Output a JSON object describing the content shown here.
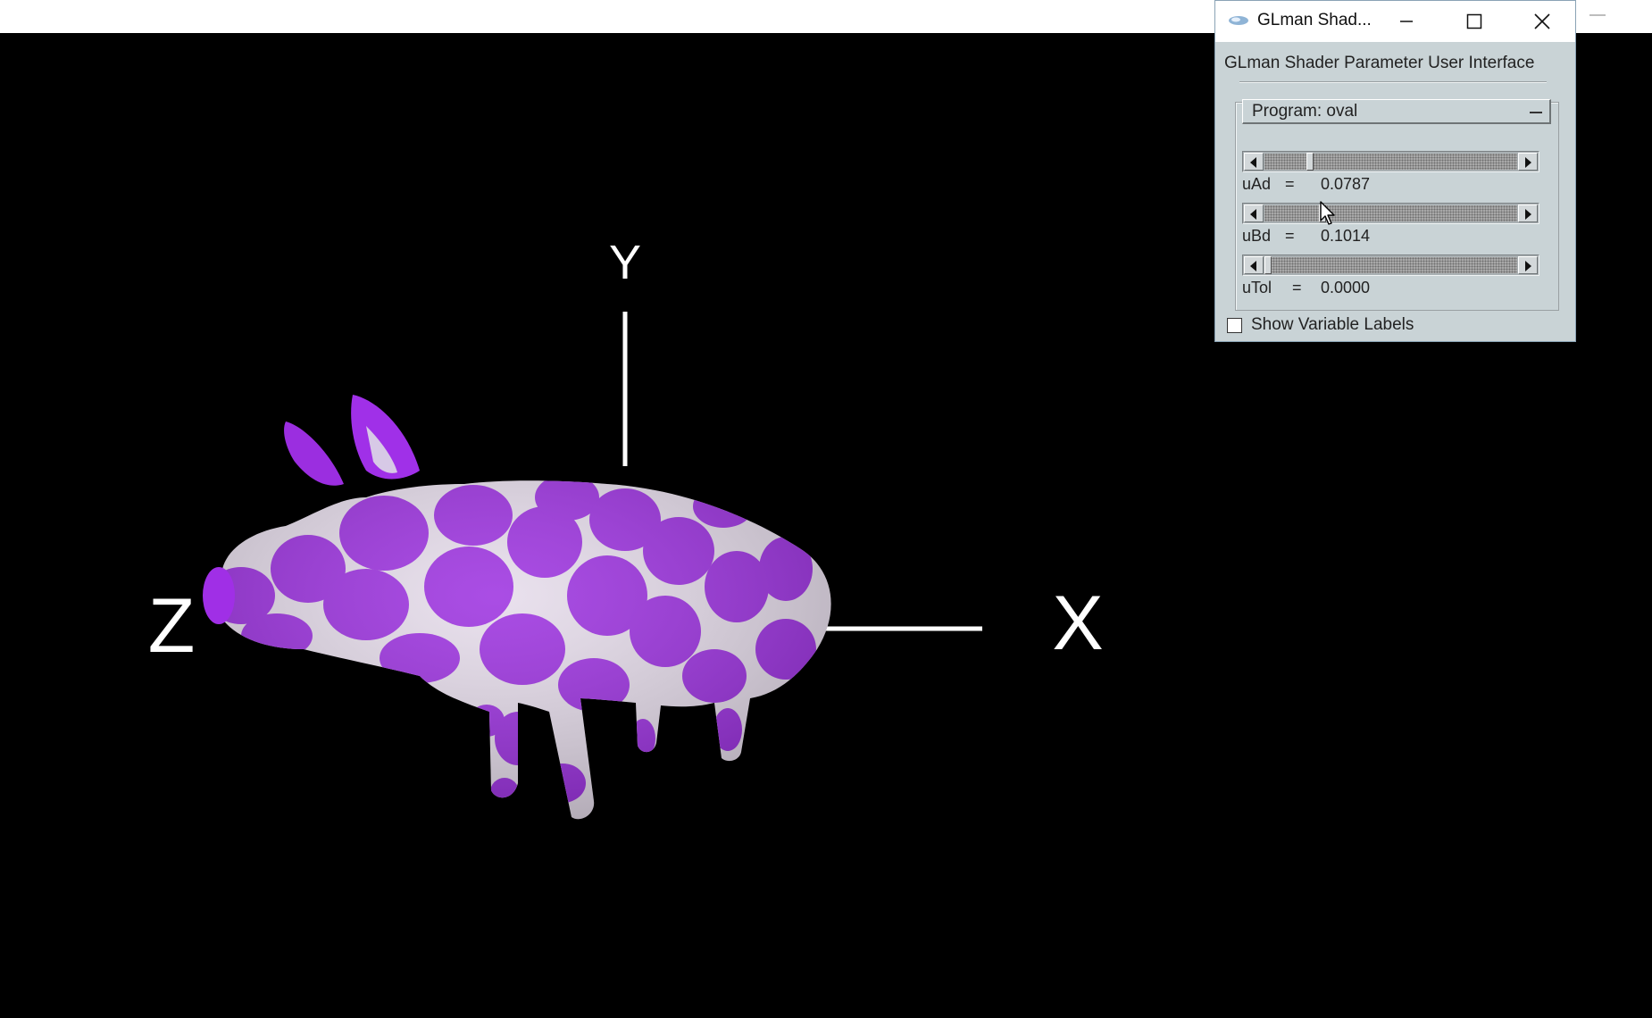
{
  "viewport": {
    "axis_labels": {
      "x": "X",
      "y": "Y",
      "z": "Z"
    },
    "model": "pig",
    "colors": {
      "background": "#000000",
      "axes": "#ffffff",
      "spot": "#9b2ee0",
      "base": "#e9dff0"
    }
  },
  "dialog": {
    "title": "GLman Shad...",
    "heading": "GLman Shader Parameter User Interface",
    "program_label": "Program: oval",
    "controls": {
      "minimize_icon": "minimize-icon",
      "maximize_icon": "maximize-icon",
      "close_icon": "close-icon"
    },
    "sliders": [
      {
        "name": "uAd",
        "eq": "=",
        "value": "0.0787",
        "level": 0.17
      },
      {
        "name": "uBd",
        "eq": "=",
        "value": "0.1014",
        "level": 0.22
      },
      {
        "name": "uTol",
        "eq": "=",
        "value": "0.0000",
        "level": 0.0
      }
    ],
    "checkbox": {
      "label": "Show Variable Labels",
      "checked": false
    }
  }
}
